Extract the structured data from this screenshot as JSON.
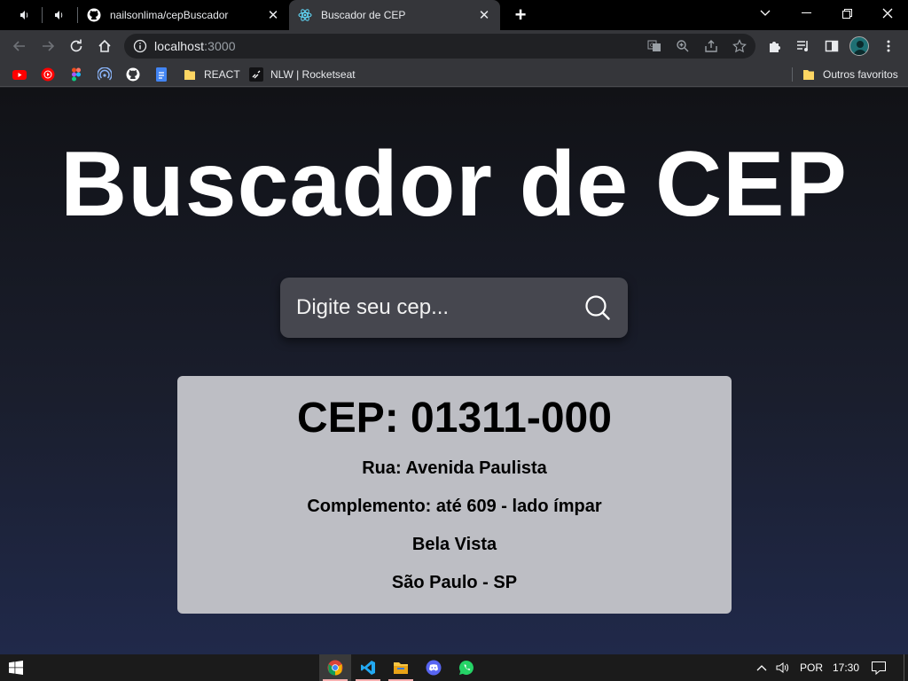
{
  "browser": {
    "tabs": [
      {
        "title": "nailsonlima/cepBuscador",
        "icon": "github-icon",
        "active": false
      },
      {
        "title": "Buscador de CEP",
        "icon": "react-icon",
        "active": true
      }
    ],
    "address": {
      "host": "localhost",
      "port": ":3000"
    },
    "bookmarks": [
      {
        "label": "",
        "icon": "youtube-icon"
      },
      {
        "label": "",
        "icon": "youtube-music-icon"
      },
      {
        "label": "",
        "icon": "figma-icon"
      },
      {
        "label": "",
        "icon": "podcast-icon"
      },
      {
        "label": "",
        "icon": "github-icon"
      },
      {
        "label": "",
        "icon": "google-docs-icon"
      },
      {
        "label": "REACT",
        "icon": "folder-icon"
      },
      {
        "label": "NLW | Rocketseat",
        "icon": "rocketseat-icon"
      }
    ],
    "other_bookmarks": "Outros favoritos"
  },
  "app": {
    "title": "Buscador de CEP",
    "search": {
      "placeholder": "Digite seu cep...",
      "value": ""
    },
    "result": {
      "cep": "CEP: 01311-000",
      "rua": "Rua: Avenida Paulista",
      "complemento": "Complemento: até 609 - lado ímpar",
      "bairro": "Bela Vista",
      "cidade": "São Paulo - SP"
    }
  },
  "taskbar": {
    "apps": [
      "chrome-icon",
      "vscode-icon",
      "file-explorer-icon",
      "discord-icon",
      "whatsapp-icon"
    ],
    "language": "POR",
    "time": "17:30"
  },
  "colors": {
    "page_top": "#111216",
    "page_bottom": "#20294a",
    "search_bg": "#46474f",
    "card_bg": "#bdbec4"
  }
}
